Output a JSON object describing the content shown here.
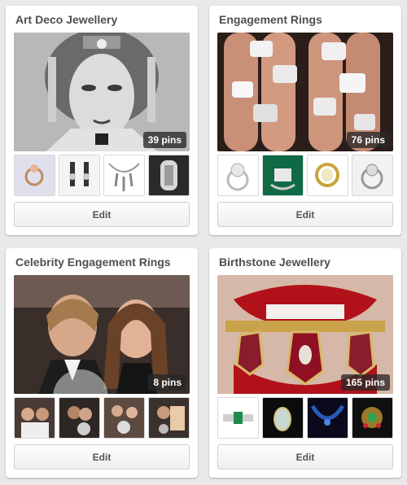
{
  "boards": [
    {
      "title": "Art Deco Jewellery",
      "pins": "39 pins",
      "edit_label": "Edit"
    },
    {
      "title": "Engagement Rings",
      "pins": "76 pins",
      "edit_label": "Edit"
    },
    {
      "title": "Celebrity Engagement Rings",
      "pins": "8 pins",
      "edit_label": "Edit"
    },
    {
      "title": "Birthstone Jewellery",
      "pins": "165 pins",
      "edit_label": "Edit"
    }
  ]
}
